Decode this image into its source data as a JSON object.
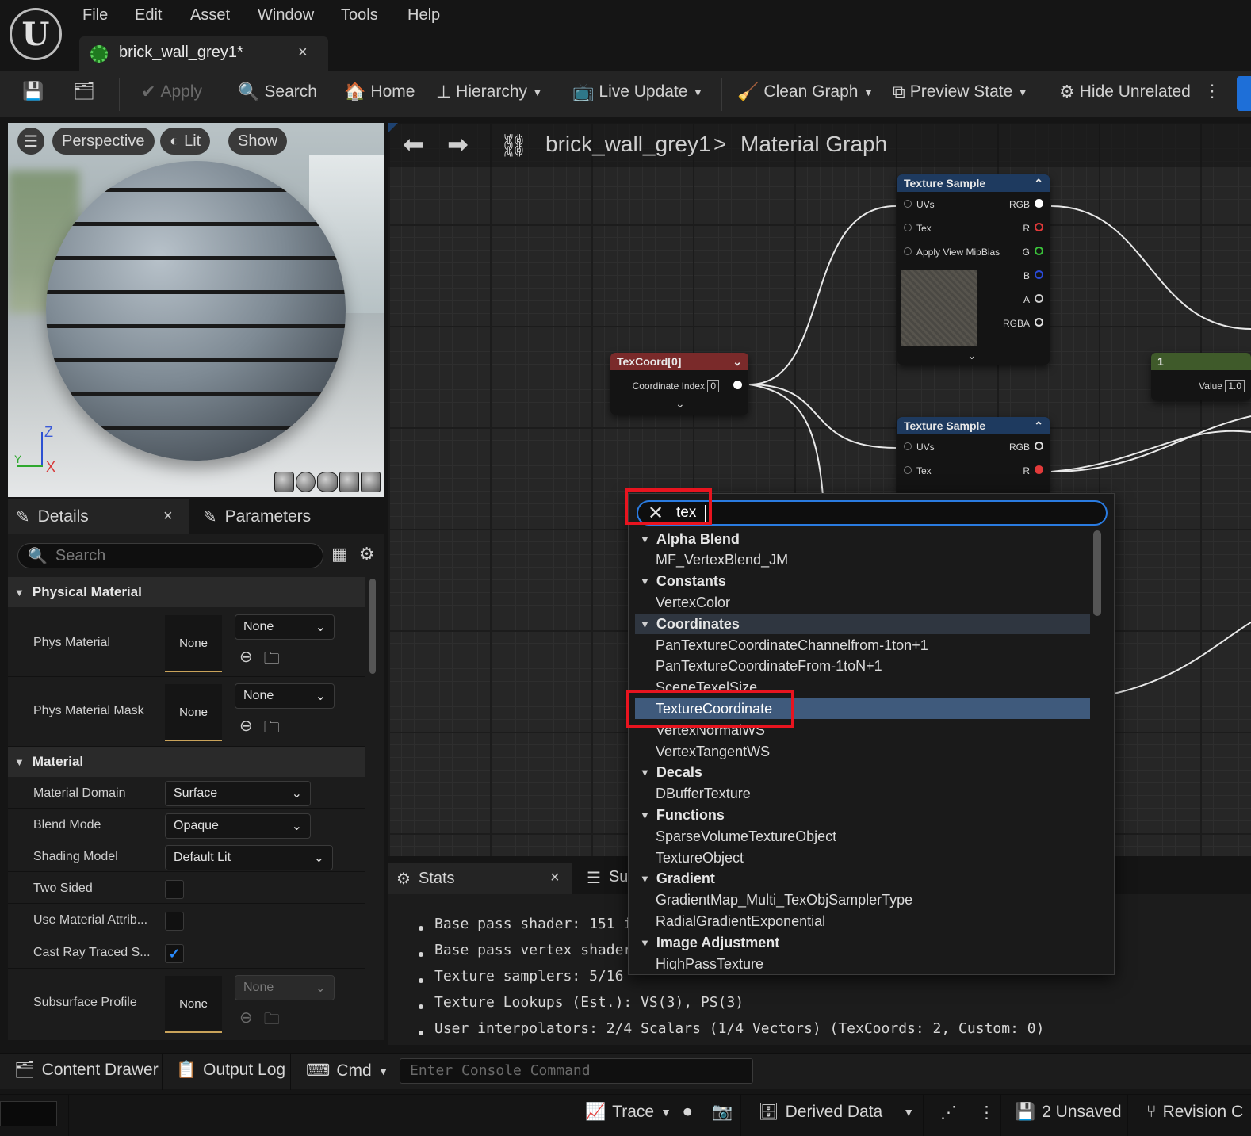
{
  "menu": {
    "items": [
      "File",
      "Edit",
      "Asset",
      "Window",
      "Tools",
      "Help"
    ]
  },
  "doc_tab": {
    "label": "brick_wall_grey1*",
    "close": "×"
  },
  "toolbar": {
    "apply": "Apply",
    "search": "Search",
    "home": "Home",
    "hierarchy": "Hierarchy",
    "live_update": "Live Update",
    "clean_graph": "Clean Graph",
    "preview_state": "Preview State",
    "hide_unrelated": "Hide Unrelated"
  },
  "viewport": {
    "perspective": "Perspective",
    "lit": "Lit",
    "show": "Show",
    "axis_z": "Z",
    "axis_x": "X",
    "axis_y": "Y"
  },
  "details": {
    "tab_details": "Details",
    "tab_parameters": "Parameters",
    "search_placeholder": "Search",
    "sections": {
      "physical_material": "Physical Material",
      "material": "Material"
    },
    "phys_material": {
      "label": "Phys Material",
      "thumb": "None",
      "combo": "None"
    },
    "phys_material_mask": {
      "label": "Phys Material Mask",
      "thumb": "None",
      "combo": "None"
    },
    "material_domain": {
      "label": "Material Domain",
      "value": "Surface"
    },
    "blend_mode": {
      "label": "Blend Mode",
      "value": "Opaque"
    },
    "shading_model": {
      "label": "Shading Model",
      "value": "Default Lit"
    },
    "two_sided": {
      "label": "Two Sided",
      "checked": false
    },
    "use_material_attrib": {
      "label": "Use Material Attrib...",
      "checked": false
    },
    "cast_ray_traced": {
      "label": "Cast Ray Traced S...",
      "checked": true
    },
    "subsurface_profile": {
      "label": "Subsurface Profile",
      "thumb": "None",
      "combo": "None"
    }
  },
  "graph": {
    "crumb_asset": "brick_wall_grey1",
    "crumb_sep": ">",
    "crumb_graph": "Material Graph"
  },
  "nodes": {
    "texture_sample_1": {
      "title": "Texture Sample",
      "pins_in": [
        "UVs",
        "Tex",
        "Apply View MipBias"
      ],
      "pins_out": [
        "RGB",
        "R",
        "G",
        "B",
        "A",
        "RGBA"
      ]
    },
    "texcoord": {
      "title": "TexCoord[0]",
      "coordinate_index_label": "Coordinate Index",
      "coordinate_index_value": "0"
    },
    "texture_sample_2": {
      "title": "Texture Sample",
      "pins_in": [
        "UVs",
        "Tex"
      ],
      "pins_out": [
        "RGB",
        "R"
      ]
    },
    "constant": {
      "title": "1",
      "value_label": "Value",
      "value": "1.0"
    }
  },
  "action_menu": {
    "search_text": "tex",
    "entries": [
      {
        "type": "cat",
        "label": "Alpha Blend"
      },
      {
        "type": "item",
        "label": "MF_VertexBlend_JM"
      },
      {
        "type": "cat",
        "label": "Constants"
      },
      {
        "type": "item",
        "label": "VertexColor"
      },
      {
        "type": "cat",
        "label": "Coordinates",
        "highlight": true
      },
      {
        "type": "item",
        "label": "PanTextureCoordinateChannelfrom-1ton+1"
      },
      {
        "type": "item",
        "label": "PanTextureCoordinateFrom-1toN+1"
      },
      {
        "type": "item",
        "label": "SceneTexelSize"
      },
      {
        "type": "item",
        "label": "TextureCoordinate",
        "selected": true
      },
      {
        "type": "item",
        "label": "VertexNormalWS"
      },
      {
        "type": "item",
        "label": "VertexTangentWS"
      },
      {
        "type": "cat",
        "label": "Decals"
      },
      {
        "type": "item",
        "label": "DBufferTexture"
      },
      {
        "type": "cat",
        "label": "Functions"
      },
      {
        "type": "item",
        "label": "SparseVolumeTextureObject"
      },
      {
        "type": "item",
        "label": "TextureObject"
      },
      {
        "type": "cat",
        "label": "Gradient"
      },
      {
        "type": "item",
        "label": "GradientMap_Multi_TexObjSamplerType"
      },
      {
        "type": "item",
        "label": "RadialGradientExponential"
      },
      {
        "type": "cat",
        "label": "Image Adjustment"
      },
      {
        "type": "item",
        "label": "HighPassTexture"
      }
    ]
  },
  "stats": {
    "tab_label": "Stats",
    "tab2_label": "Su",
    "lines": [
      "Base pass shader: 151 i",
      "Base pass vertex shader",
      "Texture samplers: 5/16",
      "Texture Lookups (Est.): VS(3), PS(3)",
      "User interpolators: 2/4 Scalars (1/4 Vectors) (TexCoords: 2, Custom: 0)"
    ]
  },
  "bottombar": {
    "content_drawer": "Content Drawer",
    "output_log": "Output Log",
    "cmd": "Cmd",
    "console_placeholder": "Enter Console Command"
  },
  "statusbar": {
    "trace": "Trace",
    "derived_data": "Derived Data",
    "unsaved": "2 Unsaved",
    "revision": "Revision C"
  }
}
